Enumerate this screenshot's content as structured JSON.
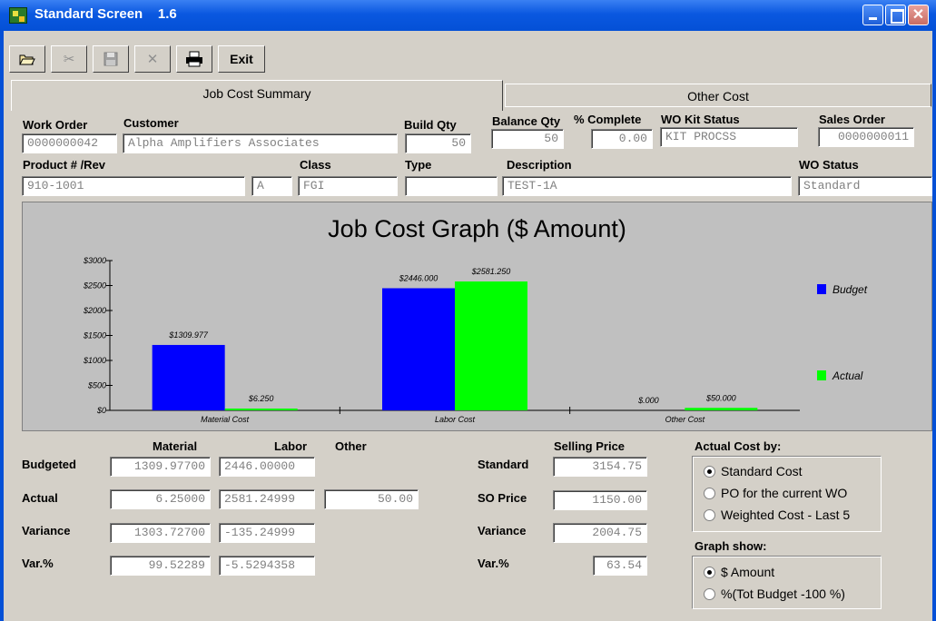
{
  "window": {
    "title": "Standard Screen    1.6"
  },
  "toolbar": {
    "exit_label": "Exit"
  },
  "tabs": {
    "summary": "Job Cost Summary",
    "other": "Other Cost"
  },
  "header": {
    "work_order_label": "Work Order",
    "work_order": "0000000042",
    "customer_label": "Customer",
    "customer": "Alpha Amplifiers Associates",
    "build_qty_label": "Build Qty",
    "build_qty": "50",
    "balance_qty_label": "Balance Qty",
    "balance_qty": "50",
    "pct_complete_label": "% Complete",
    "pct_complete": "0.00",
    "kit_status_label": "WO Kit Status",
    "kit_status": "KIT PROCSS",
    "sales_order_label": "Sales Order",
    "sales_order": "0000000011",
    "product_label": "Product # /Rev",
    "product": "910-1001",
    "rev": "A",
    "class_label": "Class",
    "class": "FGI",
    "type_label": "Type",
    "type": "",
    "description_label": "Description",
    "description": "TEST-1A",
    "wo_status_label": "WO Status",
    "wo_status": "Standard"
  },
  "chart_data": {
    "type": "bar",
    "title": "Job Cost Graph ($ Amount)",
    "categories": [
      "Material Cost",
      "Labor Cost",
      "Other Cost"
    ],
    "series": [
      {
        "name": "Budget",
        "color": "#0000ff",
        "values": [
          1309.977,
          2446.0,
          0.0
        ],
        "labels": [
          "$1309.977",
          "$2446.000",
          "$.000"
        ]
      },
      {
        "name": "Actual",
        "color": "#00ff00",
        "values": [
          6.25,
          2581.25,
          50.0
        ],
        "labels": [
          "$6.250",
          "$2581.250",
          "$50.000"
        ]
      }
    ],
    "ylim": [
      0,
      3000
    ],
    "yticks": [
      0,
      500,
      1000,
      1500,
      2000,
      2500,
      3000
    ],
    "ytick_labels": [
      "$0",
      "$500",
      "$1000",
      "$1500",
      "$2000",
      "$2500",
      "$3000"
    ],
    "legend_position": "right",
    "grid": false
  },
  "summary": {
    "col_material": "Material",
    "col_labor": "Labor",
    "col_other": "Other",
    "row_budgeted": "Budgeted",
    "row_actual": "Actual",
    "row_variance": "Variance",
    "row_varpct": "Var.%",
    "budgeted_material": "1309.97700",
    "budgeted_labor": "2446.00000",
    "actual_material": "6.25000",
    "actual_labor": "2581.24999",
    "actual_other": "50.00",
    "variance_material": "1303.72700",
    "variance_labor": "-135.24999",
    "varpct_material": "99.52289",
    "varpct_labor": "-5.5294358"
  },
  "selling": {
    "header": "Selling Price",
    "standard_label": "Standard",
    "standard": "3154.75",
    "so_price_label": "SO Price",
    "so_price": "1150.00",
    "variance_label": "Variance",
    "variance": "2004.75",
    "varpct_label": "Var.%",
    "varpct": "63.54"
  },
  "actual_cost_by": {
    "label": "Actual Cost by:",
    "options": [
      "Standard Cost",
      "PO for the current WO",
      "Weighted Cost - Last 5"
    ],
    "selected": 0
  },
  "graph_show": {
    "label": "Graph show:",
    "options": [
      "$ Amount",
      "%(Tot Budget -100 %)"
    ],
    "selected": 0
  }
}
